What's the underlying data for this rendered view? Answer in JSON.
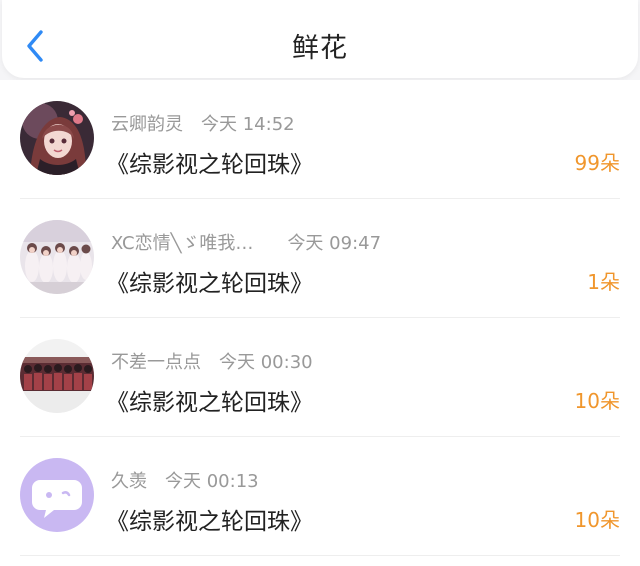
{
  "header": {
    "title": "鲜花",
    "back_icon": "chevron-left-icon",
    "accent_color": "#2f8af5"
  },
  "colors": {
    "count": "#f0962c",
    "meta": "#999999",
    "title": "#222222"
  },
  "gifts": [
    {
      "user": "云卿韵灵",
      "time": "今天 14:52",
      "book": "《综影视之轮回珠》",
      "count": "99朵"
    },
    {
      "user": "XC恋情╲ゞ唯我…",
      "time": "今天 09:47",
      "book": "《综影视之轮回珠》",
      "count": "1朵"
    },
    {
      "user": "不差一点点",
      "time": "今天 00:30",
      "book": "《综影视之轮回珠》",
      "count": "10朵"
    },
    {
      "user": "久羡",
      "time": "今天 00:13",
      "book": "《综影视之轮回珠》",
      "count": "10朵"
    }
  ]
}
